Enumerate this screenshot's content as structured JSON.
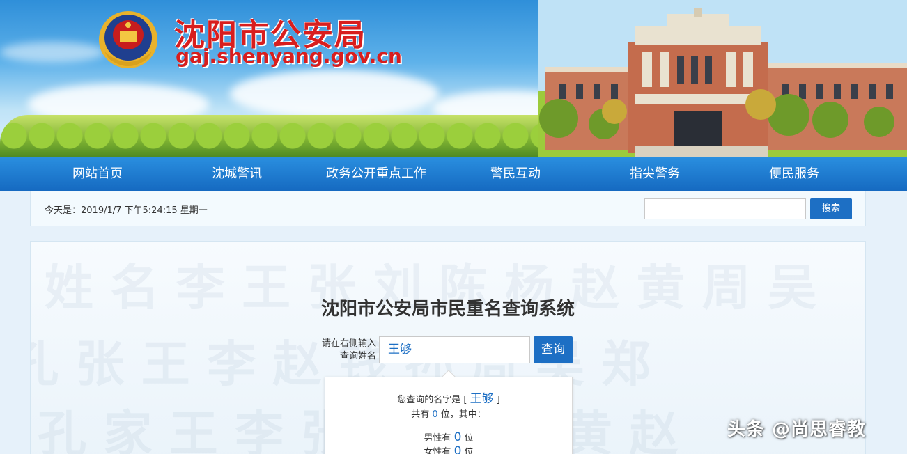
{
  "header": {
    "title": "沈阳市公安局",
    "url": "gaj.shenyang.gov.cn"
  },
  "nav": {
    "items": [
      {
        "label": "网站首页"
      },
      {
        "label": "沈城警讯"
      },
      {
        "label": "政务公开重点工作"
      },
      {
        "label": "警民互动"
      },
      {
        "label": "指尖警务"
      },
      {
        "label": "便民服务"
      }
    ]
  },
  "infobar": {
    "today": "今天是：2019/1/7 下午5:24:15 星期一",
    "search_value": "",
    "search_label": "搜索"
  },
  "main": {
    "title": "沈阳市公安局市民重名查询系统",
    "query_label": "请在右侧输入查询姓名",
    "query_value": "王够",
    "query_button": "查询",
    "result": {
      "name_prefix": "您查询的名字是 [",
      "name": "王够",
      "name_suffix": "]",
      "total_prefix": "共有",
      "total": "0",
      "total_suffix": "位，其中：",
      "male_prefix": "男性有",
      "male": "0",
      "male_suffix": "位",
      "female_prefix": "女性有",
      "female": "0",
      "female_suffix": "位"
    }
  },
  "watermark_credit": "头条 @尚思睿教",
  "colors": {
    "brand_red": "#d81e1e",
    "nav_blue": "#1569c0",
    "accent_blue": "#1d6fc4"
  }
}
